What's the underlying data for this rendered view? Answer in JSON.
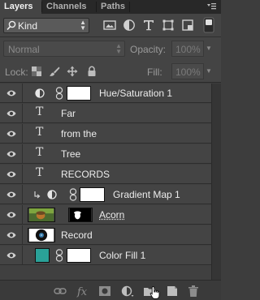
{
  "tabs": [
    {
      "label": "Layers",
      "active": true
    },
    {
      "label": "Channels",
      "active": false
    },
    {
      "label": "Paths",
      "active": false
    }
  ],
  "filter": {
    "kind_label": "Kind",
    "icons": [
      "image-filter-icon",
      "adjustment-filter-icon",
      "type-filter-icon",
      "shape-filter-icon",
      "smart-object-filter-icon",
      "filter-toggle-icon"
    ]
  },
  "blend": {
    "mode": "Normal",
    "opacity_label": "Opacity:",
    "opacity_value": "100%"
  },
  "lock": {
    "label": "Lock:",
    "fill_label": "Fill:",
    "fill_value": "100%"
  },
  "layers": [
    {
      "name": "Hue/Saturation 1",
      "kind": "adjustment",
      "icon": "hue-saturation-icon",
      "mask": "white"
    },
    {
      "name": "Far",
      "kind": "type"
    },
    {
      "name": "from the",
      "kind": "type"
    },
    {
      "name": "Tree",
      "kind": "type"
    },
    {
      "name": "RECORDS",
      "kind": "type"
    },
    {
      "name": "Gradient Map 1",
      "kind": "adjustment",
      "icon": "gradient-map-icon",
      "clipped": true,
      "mask": "white"
    },
    {
      "name": "Acorn",
      "kind": "image",
      "mask": "black-with-shape"
    },
    {
      "name": "Record",
      "kind": "image"
    },
    {
      "name": "Color Fill 1",
      "kind": "fill",
      "color": "#2aa198",
      "mask": "white"
    }
  ],
  "bottom_icons": [
    "link-layers-icon",
    "fx-icon",
    "add-mask-icon",
    "adjustment-layer-icon",
    "new-group-icon",
    "new-layer-icon",
    "trash-icon"
  ],
  "colors": {
    "panel": "#444444",
    "fill_swatch": "#2aa198"
  }
}
